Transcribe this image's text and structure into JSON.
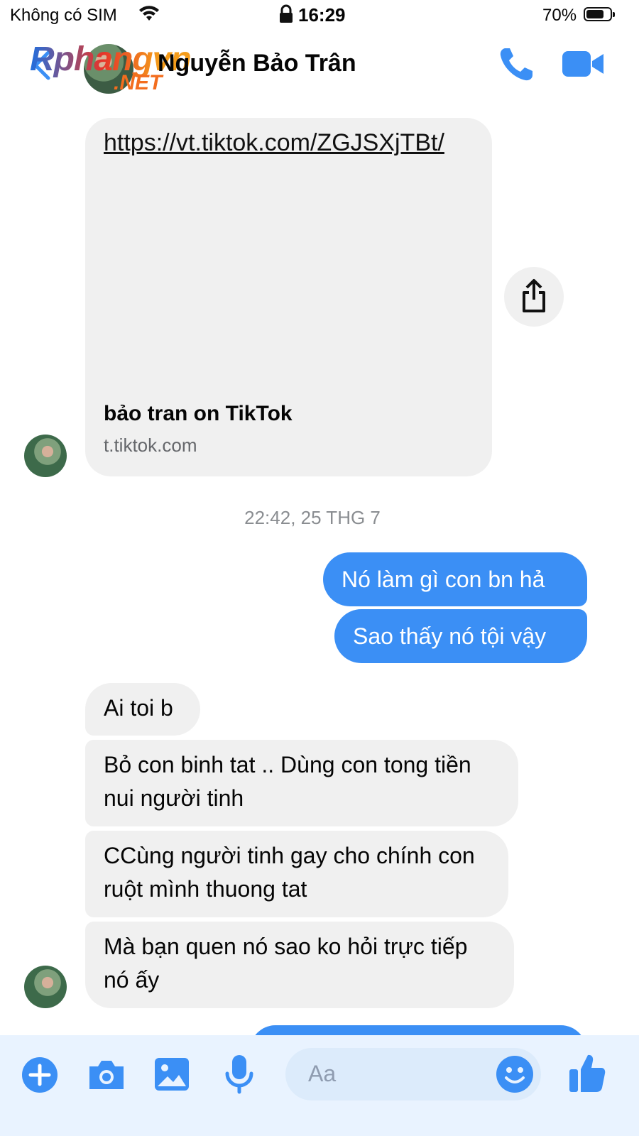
{
  "status_bar": {
    "carrier": "Không có SIM",
    "time": "16:29",
    "battery_percent": "70%"
  },
  "header": {
    "watermark_main": "Rphangvn",
    "watermark_sub": ".NET",
    "contact_name": "Nguyễn Bảo Trân"
  },
  "link_preview": {
    "url": "https://vt.tiktok.com/ZGJSXjTBt/",
    "title": "bảo tran on TikTok",
    "domain": "t.tiktok.com"
  },
  "timestamp": "22:42, 25 THG 7",
  "messages": {
    "out1": "Nó làm gì con bn hả",
    "out2": "Sao thấy nó tội vậy",
    "in1": "Ai toi b",
    "in2": "Bỏ  con binh tat ..  Dùng  con tong tiền  nui người  tinh",
    "in3": "CCùng người  tinh gay cho chính con ruột  mình  thuong tat",
    "in4": "Mà  bạn  quen nó  sao ko hỏi  trực tiếp  nó  ấy"
  },
  "composer": {
    "placeholder": "Aa"
  },
  "colors": {
    "messenger_blue": "#3b8ff5",
    "incoming_bubble": "#f0f0f0",
    "composer_bg": "#e9f3ff"
  },
  "icons": [
    "wifi-icon",
    "lock-icon",
    "battery-icon",
    "back-arrow-icon",
    "phone-icon",
    "video-camera-icon",
    "share-icon",
    "plus-icon",
    "camera-icon",
    "gallery-icon",
    "microphone-icon",
    "emoji-icon",
    "like-thumb-icon"
  ]
}
